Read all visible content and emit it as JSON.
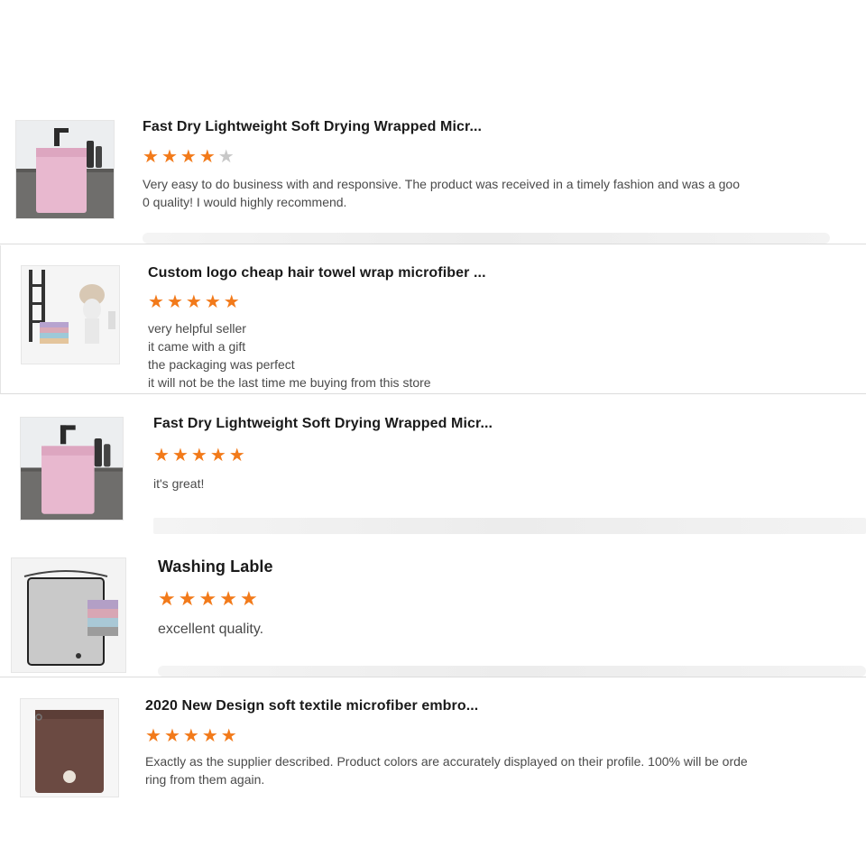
{
  "reviews": [
    {
      "title": "Fast Dry Lightweight Soft Drying Wrapped Micr...",
      "rating": 4,
      "text": [
        "Very easy to do business with and responsive. The product was received in a timely fashion and was a goo",
        "0 quality! I would highly recommend."
      ],
      "image_icon": "pink-towel-icon"
    },
    {
      "title": "Custom logo cheap hair towel wrap microfiber ...",
      "rating": 5,
      "text": [
        "very helpful seller",
        "it came with a gift",
        "the packaging was perfect",
        "it will not be the last time me buying from this store"
      ],
      "image_icon": "hair-towel-wrap-icon"
    },
    {
      "title": "Fast Dry Lightweight Soft Drying Wrapped Micr...",
      "rating": 5,
      "text": [
        "it's great!"
      ],
      "image_icon": "pink-towel-icon"
    },
    {
      "title": "Washing Lable",
      "rating": 5,
      "text": [
        "excellent quality."
      ],
      "image_icon": "gray-towel-icon"
    },
    {
      "title": "2020 New Design soft textile microfiber embro...",
      "rating": 5,
      "text": [
        "Exactly as the supplier described. Product colors are accurately displayed on their profile. 100% will be orde",
        "ring from them again."
      ],
      "image_icon": "brown-towel-icon"
    }
  ],
  "colors": {
    "star_on": "#f27a1a",
    "star_off": "#c8c8c8",
    "divider": "#dcdcdc"
  }
}
